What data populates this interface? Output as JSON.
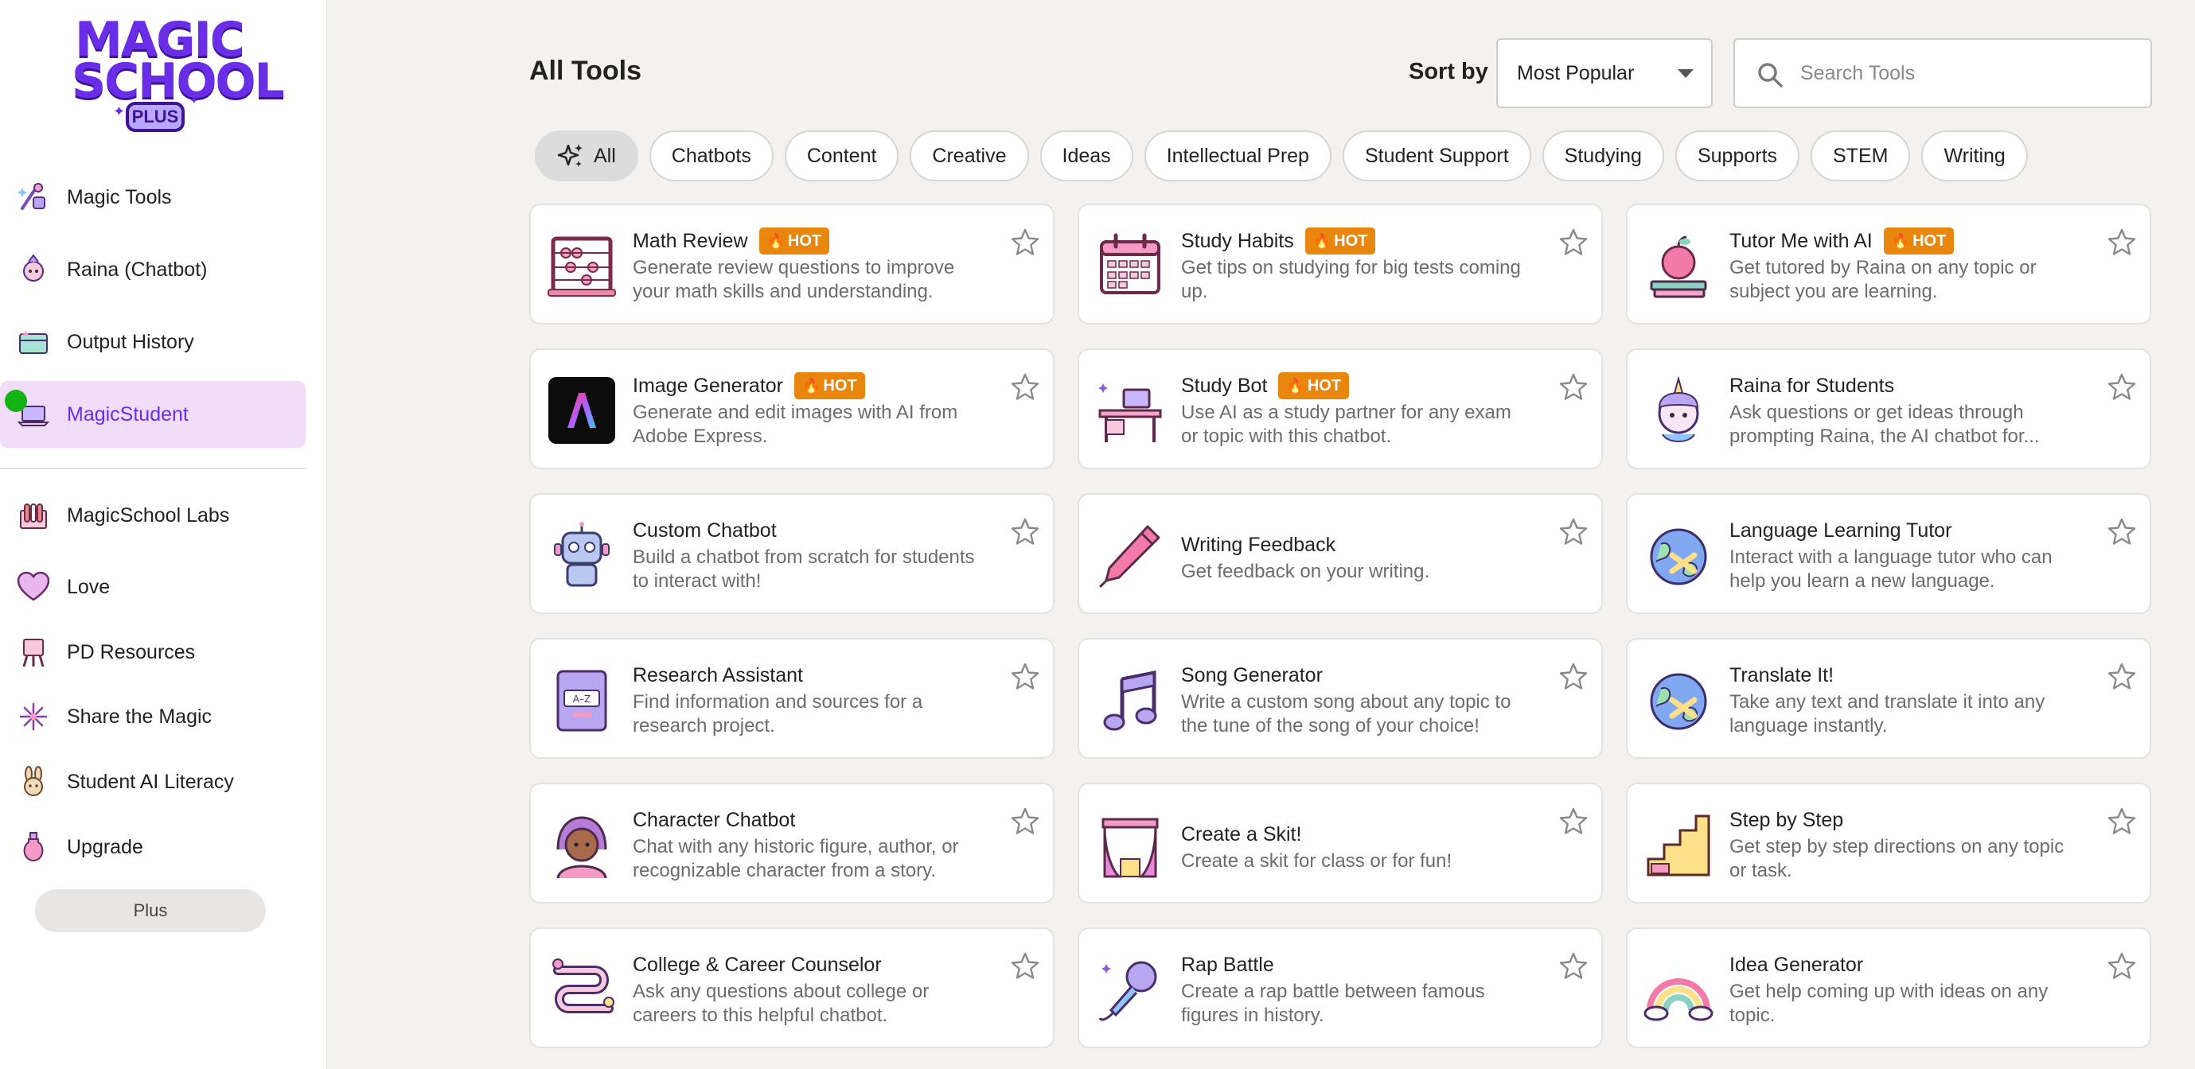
{
  "logo": {
    "line1": "MAGIC",
    "line2": "SCHOOL",
    "badge": "PLUS"
  },
  "sidebar": {
    "items": [
      {
        "label": "Magic Tools",
        "icon": "magic-tools-icon"
      },
      {
        "label": "Raina (Chatbot)",
        "icon": "raina-icon"
      },
      {
        "label": "Output History",
        "icon": "history-icon"
      },
      {
        "label": "MagicStudent",
        "icon": "laptop-icon",
        "active": true
      },
      {
        "label": "MagicSchool Labs",
        "icon": "labs-icon"
      },
      {
        "label": "Love",
        "icon": "heart-icon"
      },
      {
        "label": "PD Resources",
        "icon": "easel-icon"
      },
      {
        "label": "Share the Magic",
        "icon": "firework-icon"
      },
      {
        "label": "Student AI Literacy",
        "icon": "bunny-icon"
      },
      {
        "label": "Upgrade",
        "icon": "potion-icon"
      }
    ],
    "plan_label": "Plus"
  },
  "header": {
    "title": "All Tools",
    "sort_label": "Sort by",
    "sort_value": "Most Popular",
    "search_placeholder": "Search Tools"
  },
  "filters": [
    "All",
    "Chatbots",
    "Content",
    "Creative",
    "Ideas",
    "Intellectual Prep",
    "Student Support",
    "Studying",
    "Supports",
    "STEM",
    "Writing"
  ],
  "hot_label": "HOT",
  "tools": [
    {
      "title": "Math Review",
      "hot": true,
      "desc1": "Generate review questions to improve",
      "desc2": "your math skills and understanding.",
      "icon": "abacus-icon"
    },
    {
      "title": "Study Habits",
      "hot": true,
      "desc1": "Get tips on studying for big tests coming",
      "desc2": "up.",
      "icon": "calendar-icon"
    },
    {
      "title": "Tutor Me with AI",
      "hot": true,
      "desc1": "Get tutored by Raina on any topic or",
      "desc2": "subject you are learning.",
      "icon": "apple-books-icon"
    },
    {
      "title": "Image Generator",
      "hot": true,
      "desc1": "Generate and edit images with AI from",
      "desc2": "Adobe Express.",
      "icon": "adobe-express-icon"
    },
    {
      "title": "Study Bot",
      "hot": true,
      "desc1": "Use AI as a study partner for any exam",
      "desc2": "or topic with this chatbot.",
      "icon": "desk-icon"
    },
    {
      "title": "Raina for Students",
      "hot": false,
      "desc1": "Ask questions or get ideas through",
      "desc2": "prompting Raina, the AI chatbot for...",
      "icon": "unicorn-icon"
    },
    {
      "title": "Custom Chatbot",
      "hot": false,
      "desc1": "Build a chatbot from scratch for students",
      "desc2": "to interact with!",
      "icon": "robot-icon"
    },
    {
      "title": "Writing Feedback",
      "hot": false,
      "desc1": "Get feedback on your writing.",
      "desc2": "",
      "icon": "pen-icon"
    },
    {
      "title": "Language Learning Tutor",
      "hot": false,
      "desc1": "Interact with a language tutor who can",
      "desc2": "help you learn a new language.",
      "icon": "globe-icon"
    },
    {
      "title": "Research Assistant",
      "hot": false,
      "desc1": "Find information and sources for a",
      "desc2": "research project.",
      "icon": "book-az-icon"
    },
    {
      "title": "Song Generator",
      "hot": false,
      "desc1": "Write a custom song about any topic to",
      "desc2": "the tune of the song of your choice!",
      "icon": "music-note-icon"
    },
    {
      "title": "Translate It!",
      "hot": false,
      "desc1": "Take any text and translate it into any",
      "desc2": "language instantly.",
      "icon": "globe-icon"
    },
    {
      "title": "Character Chatbot",
      "hot": false,
      "desc1": "Chat with any historic figure, author, or",
      "desc2": "recognizable character from a story.",
      "icon": "character-icon"
    },
    {
      "title": "Create a Skit!",
      "hot": false,
      "desc1": "Create a skit for class or for fun!",
      "desc2": "",
      "icon": "stage-curtain-icon"
    },
    {
      "title": "Step by Step",
      "hot": false,
      "desc1": "Get step by step directions on any topic",
      "desc2": "or task.",
      "icon": "stairs-icon"
    },
    {
      "title": "College & Career Counselor",
      "hot": false,
      "desc1": "Ask any questions about college or",
      "desc2": "careers to this helpful chatbot.",
      "icon": "road-map-icon"
    },
    {
      "title": "Rap Battle",
      "hot": false,
      "desc1": "Create a rap battle between famous",
      "desc2": "figures in history.",
      "icon": "microphone-icon"
    },
    {
      "title": "Idea Generator",
      "hot": false,
      "desc1": "Get help coming up with ideas on any",
      "desc2": "topic.",
      "icon": "rainbow-icon"
    }
  ],
  "colors": {
    "brand": "#6a2ee8",
    "active_bg": "#f1dcfa",
    "hot": "#e8860d",
    "status": "#14b314"
  }
}
